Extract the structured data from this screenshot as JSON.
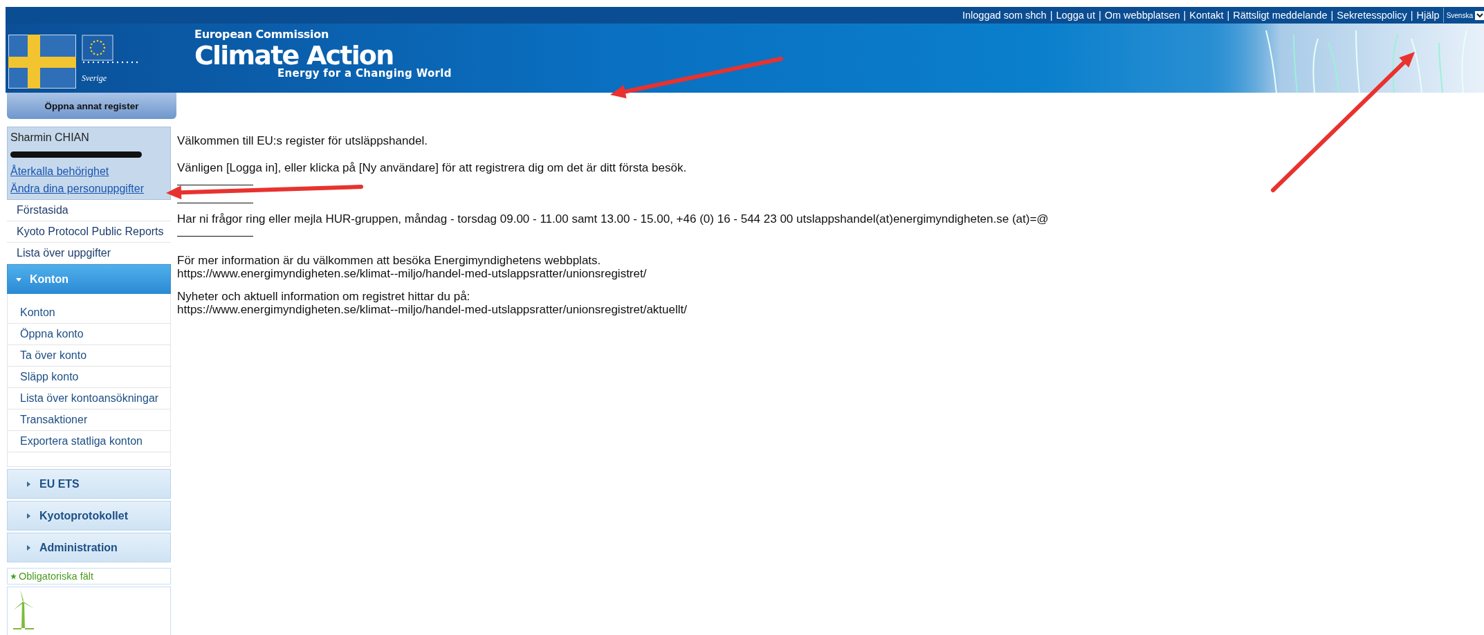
{
  "top_bar": {
    "separator": "|",
    "links": [
      "Inloggad som shch",
      "Logga ut",
      "Om webbplatsen",
      "Kontakt",
      "Rättsligt meddelande",
      "Sekretesspolicy",
      "Hjälp"
    ],
    "language": {
      "value": "Svenska"
    }
  },
  "header": {
    "country": "Sverige",
    "org": "European Commission",
    "title": "Climate Action",
    "tagline": "Energy for a Changing World"
  },
  "register_tab": "Öppna annat register",
  "user": {
    "name": "Sharmin CHIAN",
    "redacted": true,
    "links": [
      "Återkalla behörighet",
      "Ändra dina personuppgifter"
    ]
  },
  "sidebar": {
    "items": [
      {
        "kind": "link",
        "label": "Förstasida"
      },
      {
        "kind": "link",
        "label": "Kyoto Protocol Public Reports"
      },
      {
        "kind": "link",
        "label": "Lista över uppgifter"
      },
      {
        "kind": "section",
        "label": "Konton",
        "expanded": true,
        "children": [
          "Konton",
          "Öppna konto",
          "Ta över konto",
          "Släpp konto",
          "Lista över kontoansökningar",
          "Transaktioner",
          "Exportera statliga konton"
        ]
      },
      {
        "kind": "section",
        "label": "EU ETS",
        "expanded": false
      },
      {
        "kind": "section",
        "label": "Kyotoprotokollet",
        "expanded": false
      },
      {
        "kind": "section",
        "label": "Administration",
        "expanded": false
      }
    ],
    "legend": "Obligatoriska fält"
  },
  "content": {
    "blocks": [
      {
        "kind": "text",
        "text": "Välkommen till EU:s register för utsläppshandel."
      },
      {
        "kind": "text",
        "text": "Vänligen [Logga in], eller klicka på [Ny användare] för att registrera dig om det är ditt första besök."
      },
      {
        "kind": "rule"
      },
      {
        "kind": "rule"
      },
      {
        "kind": "text",
        "text": "Har ni frågor ring eller mejla HUR-gruppen, måndag - torsdag 09.00 - 11.00 samt 13.00 - 15.00, +46 (0) 16 - 544 23 00 utslappshandel(at)energimyndigheten.se (at)=@"
      },
      {
        "kind": "rule"
      },
      {
        "kind": "lines",
        "lines": [
          "För mer information är du välkommen att besöka Energimyndighetens webbplats.",
          "https://www.energimyndigheten.se/klimat--miljo/handel-med-utslappsratter/unionsregistret/"
        ]
      },
      {
        "kind": "lines",
        "lines": [
          "Nyheter och aktuell information om registret hittar du på:",
          "https://www.energimyndigheten.se/klimat--miljo/handel-med-utslappsratter/unionsregistret/aktuellt/"
        ]
      }
    ]
  },
  "annotations": [
    {
      "kind": "arrow"
    },
    {
      "kind": "arrow"
    },
    {
      "kind": "arrow"
    }
  ]
}
